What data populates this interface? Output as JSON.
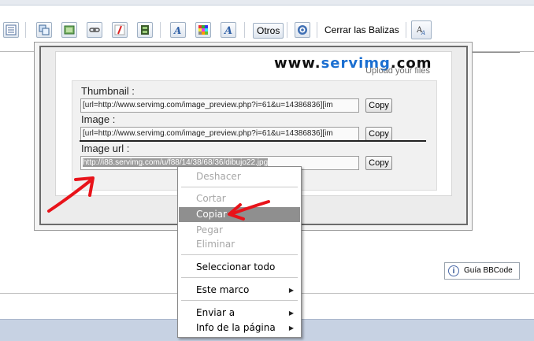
{
  "toolbar": {
    "otros_label": "Otros",
    "cerrar_label": "Cerrar las Balizas",
    "buttons": [
      "list-icon",
      "copy-image-icon",
      "image-icon",
      "link-icon",
      "flash-icon",
      "film-icon",
      "font-size-icon",
      "color-palette-icon",
      "font-icon",
      "help-icon",
      "font-style-icon"
    ]
  },
  "logo": {
    "www": "www.",
    "serv": "servimg",
    "com": ".com",
    "sub": "Upload your files"
  },
  "fields": {
    "thumbnail_label": "Thumbnail :",
    "thumbnail_value": "[url=http://www.servimg.com/image_preview.php?i=61&u=14386836][im",
    "image_label": "Image :",
    "image_value": "[url=http://www.servimg.com/image_preview.php?i=61&u=14386836][im",
    "imageurl_label": "Image url :",
    "imageurl_value": "http://i88.servimg.com/u/f88/14/38/68/36/dibujo22.jpg",
    "copy_label": "Copy"
  },
  "context_menu": {
    "items": [
      {
        "label": "Deshacer",
        "enabled": false
      },
      {
        "label": "Cortar",
        "enabled": false
      },
      {
        "label": "Copiar",
        "enabled": true,
        "highlighted": true
      },
      {
        "label": "Pegar",
        "enabled": false
      },
      {
        "label": "Eliminar",
        "enabled": false
      },
      {
        "label": "Seleccionar todo",
        "enabled": true
      },
      {
        "label": "Este marco",
        "enabled": true,
        "submenu": true
      },
      {
        "label": "Enviar a",
        "enabled": true,
        "submenu": true
      },
      {
        "label": "Info de la página",
        "enabled": true,
        "submenu": true
      }
    ]
  },
  "guia": {
    "label": "Guía BBCode",
    "icon": "info-icon"
  },
  "colors": {
    "accent_arrow": "#e8131a",
    "logo_blue": "#1b6fd1",
    "bottom_bar": "#c7d2e3"
  }
}
